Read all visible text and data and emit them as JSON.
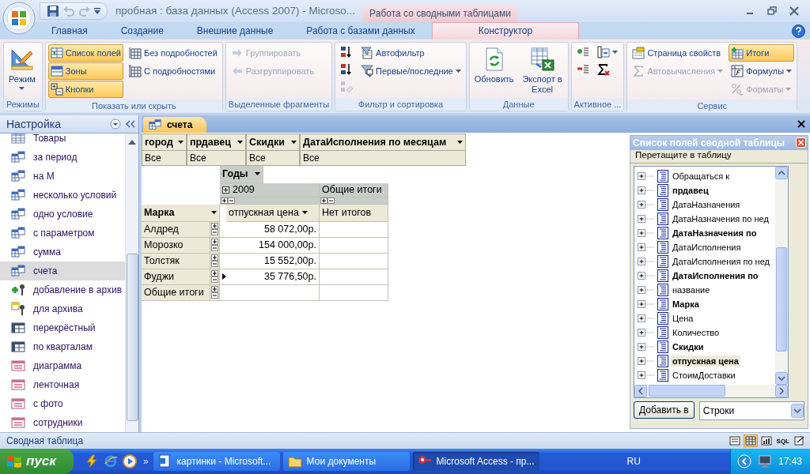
{
  "window": {
    "title": "пробная : база данных (Access 2007) - Microso...",
    "context_group": "Работа со сводными таблицами"
  },
  "quick_access": [
    {
      "kind": "save",
      "disabled": false
    },
    {
      "kind": "undo",
      "disabled": true
    },
    {
      "kind": "redo",
      "disabled": true
    }
  ],
  "ribbon_tabs": [
    {
      "label": "Главная",
      "selected": false
    },
    {
      "label": "Создание",
      "selected": false
    },
    {
      "label": "Внешние данные",
      "selected": false
    },
    {
      "label": "Работа с базами данных",
      "selected": false
    },
    {
      "label": "Конструктор",
      "selected": true
    }
  ],
  "ribbon_groups": [
    {
      "label": "Режимы",
      "columns": [
        [
          {
            "kind": "large",
            "label": "Режим",
            "pressed": false,
            "disabled": false,
            "dropdown": true
          }
        ]
      ]
    },
    {
      "label": "Показать или скрыть",
      "columns": [
        [
          {
            "kind": "small",
            "label": "Список полей",
            "pressed": true,
            "disabled": false,
            "dropdown": false
          },
          {
            "kind": "small",
            "label": "Зоны",
            "pressed": true,
            "disabled": false,
            "dropdown": false
          },
          {
            "kind": "small",
            "label": "Кнопки",
            "pressed": true,
            "disabled": false,
            "dropdown": false
          }
        ],
        [
          {
            "kind": "small",
            "label": "Без подробностей",
            "pressed": false,
            "disabled": false,
            "dropdown": false
          },
          {
            "kind": "small",
            "label": "С подробностями",
            "pressed": false,
            "disabled": false,
            "dropdown": false
          }
        ]
      ]
    },
    {
      "label": "Выделенные фрагменты",
      "columns": [
        [
          {
            "kind": "small",
            "label": "Группировать",
            "pressed": false,
            "disabled": true,
            "dropdown": false
          },
          {
            "kind": "small",
            "label": "Разгруппировать",
            "pressed": false,
            "disabled": true,
            "dropdown": false
          }
        ]
      ]
    },
    {
      "label": "Фильтр и сортировка",
      "columns": [
        [
          {
            "kind": "icon",
            "pressed": false,
            "disabled": false,
            "dropdown": false
          },
          {
            "kind": "icon",
            "pressed": false,
            "disabled": false,
            "dropdown": false
          },
          {
            "kind": "icon",
            "pressed": false,
            "disabled": true,
            "dropdown": false
          }
        ],
        [
          {
            "kind": "small",
            "label": "Автофильтр",
            "pressed": false,
            "disabled": false,
            "dropdown": false
          },
          {
            "kind": "small",
            "label": "Первые/последние",
            "pressed": false,
            "disabled": false,
            "dropdown": true
          }
        ]
      ]
    },
    {
      "label": "Данные",
      "columns": [
        [
          {
            "kind": "large",
            "label": "Обновить",
            "pressed": false,
            "disabled": false,
            "dropdown": false
          }
        ],
        [
          {
            "kind": "large",
            "label": "Экспорт в Excel",
            "pressed": false,
            "disabled": false,
            "dropdown": false
          }
        ]
      ]
    },
    {
      "label": "Активное ...",
      "columns": [
        [
          {
            "kind": "icon",
            "pressed": false,
            "disabled": false,
            "dropdown": false
          },
          {
            "kind": "icon",
            "pressed": false,
            "disabled": false,
            "dropdown": false
          }
        ],
        [
          {
            "kind": "icon",
            "pressed": false,
            "disabled": false,
            "dropdown": true
          },
          {
            "kind": "icon",
            "pressed": false,
            "disabled": false,
            "dropdown": false
          }
        ]
      ]
    },
    {
      "label": "Сервис",
      "columns": [
        [
          {
            "kind": "small",
            "label": "Страница свойств",
            "pressed": false,
            "disabled": false,
            "dropdown": false
          },
          {
            "kind": "small",
            "label": "Автовычисления",
            "pressed": false,
            "disabled": true,
            "dropdown": true
          }
        ],
        [
          {
            "kind": "small",
            "label": "Итоги",
            "pressed": true,
            "disabled": false,
            "dropdown": false
          },
          {
            "kind": "small",
            "label": "Формулы",
            "pressed": false,
            "disabled": false,
            "dropdown": true
          },
          {
            "kind": "small",
            "label": "Форматы",
            "pressed": false,
            "disabled": true,
            "dropdown": true
          }
        ]
      ]
    }
  ],
  "navigation": {
    "title": "Настройка",
    "items": [
      {
        "label": "Товары",
        "kind": "table",
        "selected": false
      },
      {
        "label": "за период",
        "kind": "query",
        "selected": false
      },
      {
        "label": "на М",
        "kind": "query",
        "selected": false
      },
      {
        "label": "несколько условий",
        "kind": "query",
        "selected": false
      },
      {
        "label": "одно условие",
        "kind": "query",
        "selected": false
      },
      {
        "label": "с параметром",
        "kind": "query",
        "selected": false
      },
      {
        "label": "сумма",
        "kind": "query",
        "selected": false
      },
      {
        "label": "счета",
        "kind": "query",
        "selected": true
      },
      {
        "label": "добавление в архив",
        "kind": "append",
        "selected": false
      },
      {
        "label": "для архива",
        "kind": "make_table",
        "selected": false
      },
      {
        "label": "перекрёстный",
        "kind": "crosstab",
        "selected": false
      },
      {
        "label": "по кварталам",
        "kind": "crosstab",
        "selected": false
      },
      {
        "label": "диаграмма",
        "kind": "form",
        "selected": false
      },
      {
        "label": "ленточная",
        "kind": "form",
        "selected": false
      },
      {
        "label": "с фото",
        "kind": "form",
        "selected": false
      },
      {
        "label": "сотрудники",
        "kind": "form",
        "selected": false
      }
    ]
  },
  "document_tabs": [
    {
      "label": "счета",
      "selected": true
    }
  ],
  "pivot": {
    "filter_fields": [
      {
        "name": "город",
        "value": "Все"
      },
      {
        "name": "прдавец",
        "value": "Все"
      },
      {
        "name": "Скидки",
        "value": "Все"
      },
      {
        "name": "ДатаИсполнения по месяцам",
        "value": "Все"
      }
    ],
    "column_field": "Годы",
    "column_item": "2009",
    "column_total": "Общие итоги",
    "row_field": "Марка",
    "data_field": "отпускная цена",
    "total_note": "Нет итогов",
    "rows": [
      {
        "label": "Алдред",
        "value": "58 072,00р.",
        "current": false
      },
      {
        "label": "Морозко",
        "value": "154 000,00р.",
        "current": false
      },
      {
        "label": "Толстяк",
        "value": "15 552,00р.",
        "current": false
      },
      {
        "label": "Фуджи",
        "value": "35 776,50р.",
        "current": true
      }
    ],
    "grand_total_row": "Общие итоги"
  },
  "field_list": {
    "title": "Список полей сводной таблицы",
    "caption": "Перетащите в таблицу",
    "fields": [
      {
        "label": "Обращаться к",
        "bold": false,
        "selected": false
      },
      {
        "label": "прдавец",
        "bold": true,
        "selected": false
      },
      {
        "label": "ДатаНазначения",
        "bold": false,
        "selected": false
      },
      {
        "label": "ДатаНазначения по нед",
        "bold": false,
        "selected": false
      },
      {
        "label": "ДатаНазначения по",
        "bold": true,
        "selected": false
      },
      {
        "label": "ДатаИсполнения",
        "bold": false,
        "selected": false
      },
      {
        "label": "ДатаИсполнения по нед",
        "bold": false,
        "selected": false
      },
      {
        "label": "ДатаИсполнения по",
        "bold": true,
        "selected": false
      },
      {
        "label": "название",
        "bold": false,
        "selected": false
      },
      {
        "label": "Марка",
        "bold": true,
        "selected": false
      },
      {
        "label": "Цена",
        "bold": false,
        "selected": false
      },
      {
        "label": "Количество",
        "bold": false,
        "selected": false
      },
      {
        "label": "Скидки",
        "bold": true,
        "selected": false
      },
      {
        "label": "отпускная цена",
        "bold": true,
        "selected": true
      },
      {
        "label": "СтоимДоставки",
        "bold": false,
        "selected": false
      }
    ],
    "add_button": "Добавить в",
    "area": "Строки"
  },
  "status_bar": {
    "text": "Сводная таблица",
    "views": [
      {
        "kind": "form",
        "selected": false
      },
      {
        "kind": "pivot",
        "selected": true
      },
      {
        "kind": "chart",
        "selected": false
      },
      {
        "kind": "sql",
        "label": "SQL",
        "selected": false
      },
      {
        "kind": "design",
        "selected": false
      }
    ]
  },
  "taskbar": {
    "start": "пуск",
    "more": "»",
    "tasks": [
      {
        "label": "картинки - Microsoft...",
        "kind": "word",
        "selected": false
      },
      {
        "label": "Мои документы",
        "kind": "folder",
        "selected": false
      },
      {
        "label": "Microsoft Access - пр...",
        "kind": "access",
        "selected": true
      }
    ],
    "language": "RU",
    "clock": "17:43"
  }
}
